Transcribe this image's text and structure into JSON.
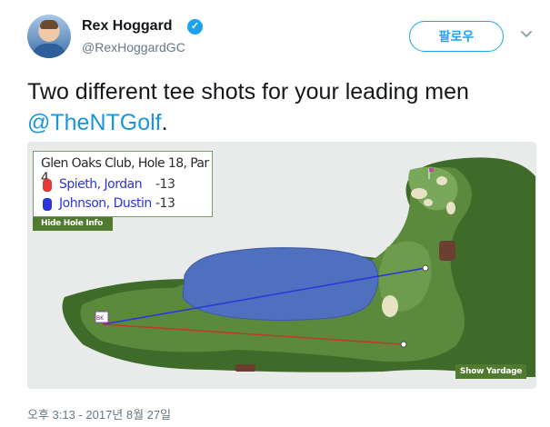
{
  "author": {
    "name": "Rex Hoggard",
    "handle": "@RexHoggardGC",
    "verified_mark": "✓"
  },
  "follow_button": {
    "label": "팔로우"
  },
  "tweet": {
    "text": "Two different tee shots for your leading men",
    "mention": "@TheNTGolf",
    "trailing": "."
  },
  "media": {
    "hole_title": "Glen Oaks Club, Hole 18, Par 4",
    "players": [
      {
        "name": "Spieth, Jordan",
        "score": "-13",
        "color": "#e23a3a"
      },
      {
        "name": "Johnson, Dustin",
        "score": "-13",
        "color": "#2b35d8"
      }
    ],
    "hide_info_label": "Hide Hole Info",
    "show_yardage_label": "Show Yardage",
    "tee_marker": "BK",
    "green_flag_color": "#c04aa0"
  },
  "timestamp": "오후 3:13 - 2017년 8월 27일",
  "icons": {
    "verified": "verified-badge-icon",
    "more": "chevron-down-icon"
  },
  "colors": {
    "accent": "#1da1f2",
    "link": "#1b95e0",
    "fairway": "#5c8a3c",
    "water": "#4f6fbf"
  }
}
